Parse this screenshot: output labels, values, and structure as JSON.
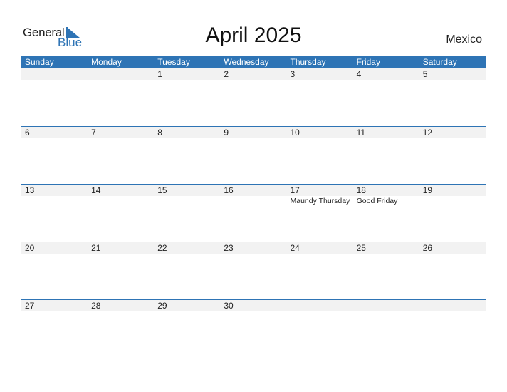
{
  "logo": {
    "general": "General",
    "blue": "Blue"
  },
  "title": "April 2025",
  "country": "Mexico",
  "colors": {
    "accent": "#2e74b5",
    "date_row_bg": "#f2f2f2"
  },
  "weekdays": [
    "Sunday",
    "Monday",
    "Tuesday",
    "Wednesday",
    "Thursday",
    "Friday",
    "Saturday"
  ],
  "weeks": [
    {
      "days": [
        "",
        "",
        "1",
        "2",
        "3",
        "4",
        "5"
      ],
      "events": [
        "",
        "",
        "",
        "",
        "",
        "",
        ""
      ]
    },
    {
      "days": [
        "6",
        "7",
        "8",
        "9",
        "10",
        "11",
        "12"
      ],
      "events": [
        "",
        "",
        "",
        "",
        "",
        "",
        ""
      ]
    },
    {
      "days": [
        "13",
        "14",
        "15",
        "16",
        "17",
        "18",
        "19"
      ],
      "events": [
        "",
        "",
        "",
        "",
        "Maundy Thursday",
        "Good Friday",
        ""
      ]
    },
    {
      "days": [
        "20",
        "21",
        "22",
        "23",
        "24",
        "25",
        "26"
      ],
      "events": [
        "",
        "",
        "",
        "",
        "",
        "",
        ""
      ]
    },
    {
      "days": [
        "27",
        "28",
        "29",
        "30",
        "",
        "",
        ""
      ],
      "events": [
        "",
        "",
        "",
        "",
        "",
        "",
        ""
      ]
    }
  ]
}
